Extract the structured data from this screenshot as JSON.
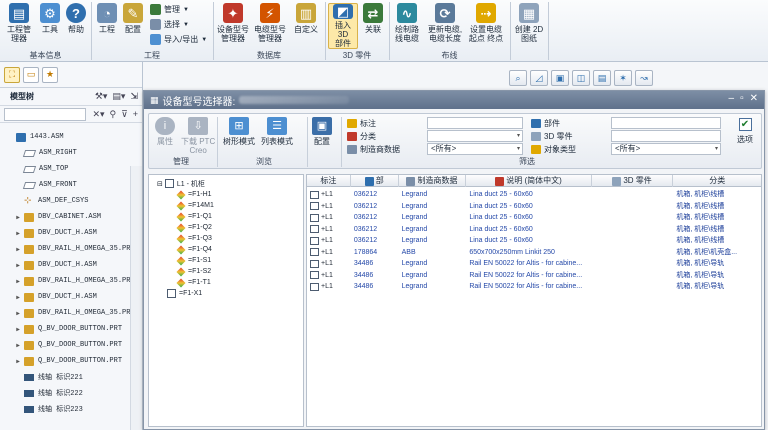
{
  "ribbon": {
    "groups": [
      {
        "label": "基本信息",
        "buttons": [
          {
            "label": "工程管\n理器",
            "icon": "project-manager-icon"
          },
          {
            "label": "工具",
            "icon": "tools-icon"
          },
          {
            "label": "帮助",
            "icon": "help-icon"
          }
        ]
      },
      {
        "label": "工程",
        "buttons": [
          {
            "label": "工程",
            "icon": "project-icon"
          },
          {
            "label": "配置",
            "icon": "config-icon"
          }
        ],
        "small": [
          {
            "label": "管理",
            "icon": "manage-icon"
          },
          {
            "label": "选择",
            "icon": "select-icon"
          },
          {
            "label": "导入/导出",
            "icon": "import-export-icon"
          }
        ]
      },
      {
        "label": "数据库",
        "buttons": [
          {
            "label": "设备型号\n管理器",
            "icon": "device-model-manager-icon"
          },
          {
            "label": "电缆型号\n管理器",
            "icon": "cable-model-manager-icon"
          },
          {
            "label": "自定义",
            "icon": "custom-icon"
          }
        ]
      },
      {
        "label": "3D 零件",
        "buttons": [
          {
            "label": "插入 3D\n部件",
            "icon": "insert-3d-part-icon"
          },
          {
            "label": "关联",
            "icon": "associate-icon"
          }
        ]
      },
      {
        "label": "布线",
        "buttons": [
          {
            "label": "绘制路\n线电缆",
            "icon": "route-cable-icon"
          },
          {
            "label": "更新电缆,\n电缆长度",
            "icon": "update-cable-icon"
          },
          {
            "label": "设置电缆\n起点 终点",
            "icon": "cable-endpoints-icon"
          }
        ]
      },
      {
        "label": "",
        "buttons": [
          {
            "label": "创建 2D\n图纸",
            "icon": "create-2d-drawing-icon"
          }
        ]
      }
    ]
  },
  "model_tree": {
    "title": "模型树",
    "search_value": "",
    "items": [
      {
        "label": "1443.ASM",
        "type": "asm",
        "expander": ""
      },
      {
        "label": "ASM_RIGHT",
        "type": "plane",
        "expander": ""
      },
      {
        "label": "ASM_TOP",
        "type": "plane",
        "expander": ""
      },
      {
        "label": "ASM_FRONT",
        "type": "plane",
        "expander": ""
      },
      {
        "label": "ASM_DEF_CSYS",
        "type": "csys",
        "expander": ""
      },
      {
        "label": "DBV_CABINET.ASM",
        "type": "prt",
        "expander": "▶"
      },
      {
        "label": "DBV_DUCT_H.ASM",
        "type": "prt",
        "expander": "▶"
      },
      {
        "label": "DBV_RAIL_H_OMEGA_35.PR",
        "type": "prt",
        "expander": "▶"
      },
      {
        "label": "DBV_DUCT_H.ASM",
        "type": "prt",
        "expander": "▶"
      },
      {
        "label": "DBV_RAIL_H_OMEGA_35.PR",
        "type": "prt",
        "expander": "▶"
      },
      {
        "label": "DBV_DUCT_H.ASM",
        "type": "prt",
        "expander": "▶"
      },
      {
        "label": "DBV_RAIL_H_OMEGA_35.PR",
        "type": "prt",
        "expander": "▶"
      },
      {
        "label": "Q_BV_DOOR_BUTTON.PRT",
        "type": "prt",
        "expander": "▶"
      },
      {
        "label": "Q_BV_DOOR_BUTTON.PRT",
        "type": "prt",
        "expander": "▶"
      },
      {
        "label": "Q_BV_DOOR_BUTTON.PRT",
        "type": "prt",
        "expander": "▶"
      },
      {
        "label": "线轴 标识221",
        "type": "sub",
        "expander": ""
      },
      {
        "label": "线轴 标识222",
        "type": "sub",
        "expander": ""
      },
      {
        "label": "线轴 标识223",
        "type": "sub",
        "expander": ""
      }
    ]
  },
  "dialog": {
    "title": "设备型号选择器:",
    "buttons": {
      "properties": "属性",
      "download": "下载 PTC\nCreo",
      "tree_mode": "树形模式",
      "list_mode": "列表模式",
      "config": "配置",
      "options": "选项"
    },
    "groups": {
      "manage": "管理",
      "browse": "浏览",
      "filter": "筛选"
    },
    "filters": {
      "mark": "标注",
      "category": "分类",
      "manufacturer_data": "制造商数据",
      "manufacturer_value": "<所有>",
      "part": "部件",
      "part_3d": "3D 零件",
      "object_type": "对象类型",
      "object_type_value": "<所有>"
    },
    "tree": {
      "root": "L1 - 机柜",
      "children": [
        "=F1-H1",
        "=F14M1",
        "=F1-Q1",
        "=F1-Q2",
        "=F1-Q3",
        "=F1-Q4",
        "=F1-S1",
        "=F1-S2",
        "=F1-T1",
        "=F1-X1"
      ]
    },
    "table": {
      "columns": [
        "标注",
        "部",
        "制造商数据",
        "说明 (简体中文)",
        "3D 零件",
        "分类"
      ],
      "rows": [
        {
          "mark": "+L1",
          "part": "036212",
          "mfr": "Legrand",
          "desc": "Lina duct 25 - 60x60",
          "part3d": "",
          "cat": "机箱, 机柜\\线槽"
        },
        {
          "mark": "+L1",
          "part": "036212",
          "mfr": "Legrand",
          "desc": "Lina duct 25 - 60x60",
          "part3d": "",
          "cat": "机箱, 机柜\\线槽"
        },
        {
          "mark": "+L1",
          "part": "036212",
          "mfr": "Legrand",
          "desc": "Lina duct 25 - 60x60",
          "part3d": "",
          "cat": "机箱, 机柜\\线槽"
        },
        {
          "mark": "+L1",
          "part": "036212",
          "mfr": "Legrand",
          "desc": "Lina duct 25 - 60x60",
          "part3d": "",
          "cat": "机箱, 机柜\\线槽"
        },
        {
          "mark": "+L1",
          "part": "036212",
          "mfr": "Legrand",
          "desc": "Lina duct 25 - 60x60",
          "part3d": "",
          "cat": "机箱, 机柜\\线槽"
        },
        {
          "mark": "+L1",
          "part": "178864",
          "mfr": "ABB",
          "desc": "650x700x250mm Linkit 250",
          "part3d": "",
          "cat": "机箱, 机柜\\机壳盒..."
        },
        {
          "mark": "+L1",
          "part": "34486",
          "mfr": "Legrand",
          "desc": "Rail EN 50022 for Altis - for cabine...",
          "part3d": "",
          "cat": "机箱, 机柜\\导轨"
        },
        {
          "mark": "+L1",
          "part": "34486",
          "mfr": "Legrand",
          "desc": "Rail EN 50022 for Altis - for cabine...",
          "part3d": "",
          "cat": "机箱, 机柜\\导轨"
        },
        {
          "mark": "+L1",
          "part": "34486",
          "mfr": "Legrand",
          "desc": "Rail EN 50022 for Altis - for cabine...",
          "part3d": "",
          "cat": "机箱, 机柜\\导轨"
        }
      ]
    }
  },
  "colors": {
    "accent": "#2f6fae",
    "link_text": "#2448a8",
    "title_bar": "#6b7d96"
  }
}
